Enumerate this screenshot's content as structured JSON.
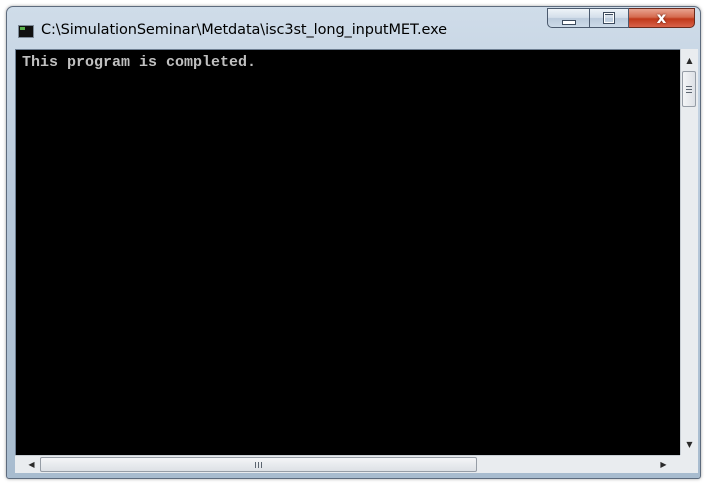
{
  "window": {
    "title": "C:\\SimulationSeminar\\Metdata\\isc3st_long_inputMET.exe",
    "icon": "console-app-icon",
    "close_glyph": "x"
  },
  "console": {
    "output": "This program is completed."
  },
  "scrollbars": {
    "vertical": {
      "up_arrow": "▲",
      "down_arrow": "▼"
    },
    "horizontal": {
      "left_arrow": "◀",
      "right_arrow": "▶"
    }
  },
  "colors": {
    "console_background": "#000000",
    "console_text": "#c0c0c0",
    "close_button": "#c0391a"
  }
}
